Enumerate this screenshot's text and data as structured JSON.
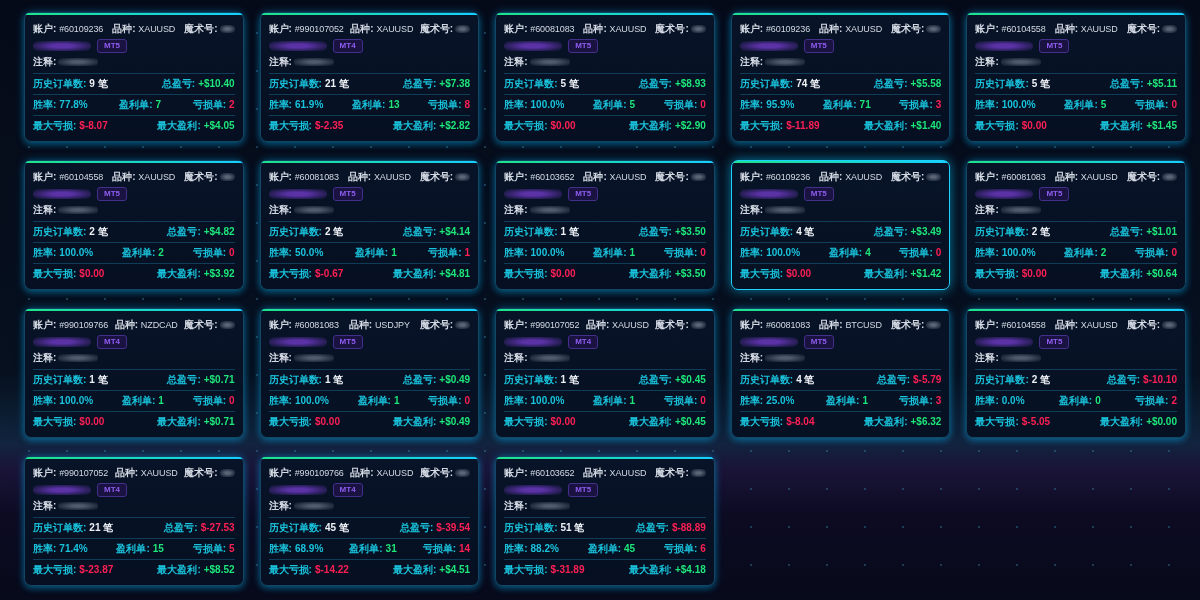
{
  "cards": [
    {
      "selected": false,
      "account": {
        "label": "账户:",
        "value": "#60109236"
      },
      "symbol": {
        "label": "品种:",
        "value": "XAUUSD"
      },
      "magic": {
        "label": "魔术号:"
      },
      "platform": "MT5",
      "note": {
        "label": "注释:"
      },
      "orders": {
        "label": "历史订单数:",
        "value": "9 笔"
      },
      "total_pnl": {
        "label": "总盈亏:",
        "value": "+$10.40",
        "color": "#1ee67a"
      },
      "win_rate": {
        "label": "胜率:",
        "value": "77.8%"
      },
      "wins": {
        "label": "盈利单:",
        "value": "7"
      },
      "losses": {
        "label": "亏损单:",
        "value": "2"
      },
      "max_loss": {
        "label": "最大亏损:",
        "value": "$-8.07"
      },
      "max_profit": {
        "label": "最大盈利:",
        "value": "+$4.05"
      }
    },
    {
      "selected": false,
      "account": {
        "label": "账户:",
        "value": "#990107052"
      },
      "symbol": {
        "label": "品种:",
        "value": "XAUUSD"
      },
      "magic": {
        "label": "魔术号:"
      },
      "platform": "MT4",
      "note": {
        "label": "注释:"
      },
      "orders": {
        "label": "历史订单数:",
        "value": "21 笔"
      },
      "total_pnl": {
        "label": "总盈亏:",
        "value": "+$7.38",
        "color": "#1ee67a"
      },
      "win_rate": {
        "label": "胜率:",
        "value": "61.9%"
      },
      "wins": {
        "label": "盈利单:",
        "value": "13"
      },
      "losses": {
        "label": "亏损单:",
        "value": "8"
      },
      "max_loss": {
        "label": "最大亏损:",
        "value": "$-2.35"
      },
      "max_profit": {
        "label": "最大盈利:",
        "value": "+$2.82"
      }
    },
    {
      "selected": false,
      "account": {
        "label": "账户:",
        "value": "#60081083"
      },
      "symbol": {
        "label": "品种:",
        "value": "XAUUSD"
      },
      "magic": {
        "label": "魔术号:"
      },
      "platform": "MT5",
      "note": {
        "label": "注释:"
      },
      "orders": {
        "label": "历史订单数:",
        "value": "5 笔"
      },
      "total_pnl": {
        "label": "总盈亏:",
        "value": "+$8.93",
        "color": "#1ee67a"
      },
      "win_rate": {
        "label": "胜率:",
        "value": "100.0%"
      },
      "wins": {
        "label": "盈利单:",
        "value": "5"
      },
      "losses": {
        "label": "亏损单:",
        "value": "0"
      },
      "max_loss": {
        "label": "最大亏损:",
        "value": "$0.00"
      },
      "max_profit": {
        "label": "最大盈利:",
        "value": "+$2.90"
      }
    },
    {
      "selected": false,
      "account": {
        "label": "账户:",
        "value": "#60109236"
      },
      "symbol": {
        "label": "品种:",
        "value": "XAUUSD"
      },
      "magic": {
        "label": "魔术号:"
      },
      "platform": "MT5",
      "note": {
        "label": "注释:"
      },
      "orders": {
        "label": "历史订单数:",
        "value": "74 笔"
      },
      "total_pnl": {
        "label": "总盈亏:",
        "value": "+$5.58",
        "color": "#1ee67a"
      },
      "win_rate": {
        "label": "胜率:",
        "value": "95.9%"
      },
      "wins": {
        "label": "盈利单:",
        "value": "71"
      },
      "losses": {
        "label": "亏损单:",
        "value": "3"
      },
      "max_loss": {
        "label": "最大亏损:",
        "value": "$-11.89"
      },
      "max_profit": {
        "label": "最大盈利:",
        "value": "+$1.40"
      }
    },
    {
      "selected": false,
      "account": {
        "label": "账户:",
        "value": "#60104558"
      },
      "symbol": {
        "label": "品种:",
        "value": "XAUUSD"
      },
      "magic": {
        "label": "魔术号:"
      },
      "platform": "MT5",
      "note": {
        "label": "注释:"
      },
      "orders": {
        "label": "历史订单数:",
        "value": "5 笔"
      },
      "total_pnl": {
        "label": "总盈亏:",
        "value": "+$5.11",
        "color": "#1ee67a"
      },
      "win_rate": {
        "label": "胜率:",
        "value": "100.0%"
      },
      "wins": {
        "label": "盈利单:",
        "value": "5"
      },
      "losses": {
        "label": "亏损单:",
        "value": "0"
      },
      "max_loss": {
        "label": "最大亏损:",
        "value": "$0.00"
      },
      "max_profit": {
        "label": "最大盈利:",
        "value": "+$1.45"
      }
    },
    {
      "selected": false,
      "account": {
        "label": "账户:",
        "value": "#60104558"
      },
      "symbol": {
        "label": "品种:",
        "value": "XAUUSD"
      },
      "magic": {
        "label": "魔术号:"
      },
      "platform": "MT5",
      "note": {
        "label": "注释:"
      },
      "orders": {
        "label": "历史订单数:",
        "value": "2 笔"
      },
      "total_pnl": {
        "label": "总盈亏:",
        "value": "+$4.82",
        "color": "#1ee67a"
      },
      "win_rate": {
        "label": "胜率:",
        "value": "100.0%"
      },
      "wins": {
        "label": "盈利单:",
        "value": "2"
      },
      "losses": {
        "label": "亏损单:",
        "value": "0"
      },
      "max_loss": {
        "label": "最大亏损:",
        "value": "$0.00"
      },
      "max_profit": {
        "label": "最大盈利:",
        "value": "+$3.92"
      }
    },
    {
      "selected": false,
      "account": {
        "label": "账户:",
        "value": "#60081083"
      },
      "symbol": {
        "label": "品种:",
        "value": "XAUUSD"
      },
      "magic": {
        "label": "魔术号:"
      },
      "platform": "MT5",
      "note": {
        "label": "注释:"
      },
      "orders": {
        "label": "历史订单数:",
        "value": "2 笔"
      },
      "total_pnl": {
        "label": "总盈亏:",
        "value": "+$4.14",
        "color": "#1ee67a"
      },
      "win_rate": {
        "label": "胜率:",
        "value": "50.0%"
      },
      "wins": {
        "label": "盈利单:",
        "value": "1"
      },
      "losses": {
        "label": "亏损单:",
        "value": "1"
      },
      "max_loss": {
        "label": "最大亏损:",
        "value": "$-0.67"
      },
      "max_profit": {
        "label": "最大盈利:",
        "value": "+$4.81"
      }
    },
    {
      "selected": false,
      "account": {
        "label": "账户:",
        "value": "#60103652"
      },
      "symbol": {
        "label": "品种:",
        "value": "XAUUSD"
      },
      "magic": {
        "label": "魔术号:"
      },
      "platform": "MT5",
      "note": {
        "label": "注释:"
      },
      "orders": {
        "label": "历史订单数:",
        "value": "1 笔"
      },
      "total_pnl": {
        "label": "总盈亏:",
        "value": "+$3.50",
        "color": "#1ee67a"
      },
      "win_rate": {
        "label": "胜率:",
        "value": "100.0%"
      },
      "wins": {
        "label": "盈利单:",
        "value": "1"
      },
      "losses": {
        "label": "亏损单:",
        "value": "0"
      },
      "max_loss": {
        "label": "最大亏损:",
        "value": "$0.00"
      },
      "max_profit": {
        "label": "最大盈利:",
        "value": "+$3.50"
      }
    },
    {
      "selected": true,
      "account": {
        "label": "账户:",
        "value": "#60109236"
      },
      "symbol": {
        "label": "品种:",
        "value": "XAUUSD"
      },
      "magic": {
        "label": "魔术号:"
      },
      "platform": "MT5",
      "note": {
        "label": "注释:"
      },
      "orders": {
        "label": "历史订单数:",
        "value": "4 笔"
      },
      "total_pnl": {
        "label": "总盈亏:",
        "value": "+$3.49",
        "color": "#1ee67a"
      },
      "win_rate": {
        "label": "胜率:",
        "value": "100.0%"
      },
      "wins": {
        "label": "盈利单:",
        "value": "4"
      },
      "losses": {
        "label": "亏损单:",
        "value": "0"
      },
      "max_loss": {
        "label": "最大亏损:",
        "value": "$0.00"
      },
      "max_profit": {
        "label": "最大盈利:",
        "value": "+$1.42"
      }
    },
    {
      "selected": false,
      "account": {
        "label": "账户:",
        "value": "#60081083"
      },
      "symbol": {
        "label": "品种:",
        "value": "XAUUSD"
      },
      "magic": {
        "label": "魔术号:"
      },
      "platform": "MT5",
      "note": {
        "label": "注释:"
      },
      "orders": {
        "label": "历史订单数:",
        "value": "2 笔"
      },
      "total_pnl": {
        "label": "总盈亏:",
        "value": "+$1.01",
        "color": "#1ee67a"
      },
      "win_rate": {
        "label": "胜率:",
        "value": "100.0%"
      },
      "wins": {
        "label": "盈利单:",
        "value": "2"
      },
      "losses": {
        "label": "亏损单:",
        "value": "0"
      },
      "max_loss": {
        "label": "最大亏损:",
        "value": "$0.00"
      },
      "max_profit": {
        "label": "最大盈利:",
        "value": "+$0.64"
      }
    },
    {
      "selected": false,
      "account": {
        "label": "账户:",
        "value": "#990109766"
      },
      "symbol": {
        "label": "品种:",
        "value": "NZDCAD"
      },
      "magic": {
        "label": "魔术号:"
      },
      "platform": "MT4",
      "note": {
        "label": "注释:"
      },
      "orders": {
        "label": "历史订单数:",
        "value": "1 笔"
      },
      "total_pnl": {
        "label": "总盈亏:",
        "value": "+$0.71",
        "color": "#1ee67a"
      },
      "win_rate": {
        "label": "胜率:",
        "value": "100.0%"
      },
      "wins": {
        "label": "盈利单:",
        "value": "1"
      },
      "losses": {
        "label": "亏损单:",
        "value": "0"
      },
      "max_loss": {
        "label": "最大亏损:",
        "value": "$0.00"
      },
      "max_profit": {
        "label": "最大盈利:",
        "value": "+$0.71"
      }
    },
    {
      "selected": false,
      "account": {
        "label": "账户:",
        "value": "#60081083"
      },
      "symbol": {
        "label": "品种:",
        "value": "USDJPY"
      },
      "magic": {
        "label": "魔术号:"
      },
      "platform": "MT5",
      "note": {
        "label": "注释:"
      },
      "orders": {
        "label": "历史订单数:",
        "value": "1 笔"
      },
      "total_pnl": {
        "label": "总盈亏:",
        "value": "+$0.49",
        "color": "#1ee67a"
      },
      "win_rate": {
        "label": "胜率:",
        "value": "100.0%"
      },
      "wins": {
        "label": "盈利单:",
        "value": "1"
      },
      "losses": {
        "label": "亏损单:",
        "value": "0"
      },
      "max_loss": {
        "label": "最大亏损:",
        "value": "$0.00"
      },
      "max_profit": {
        "label": "最大盈利:",
        "value": "+$0.49"
      }
    },
    {
      "selected": false,
      "account": {
        "label": "账户:",
        "value": "#990107052"
      },
      "symbol": {
        "label": "品种:",
        "value": "XAUUSD"
      },
      "magic": {
        "label": "魔术号:"
      },
      "platform": "MT4",
      "note": {
        "label": "注释:"
      },
      "orders": {
        "label": "历史订单数:",
        "value": "1 笔"
      },
      "total_pnl": {
        "label": "总盈亏:",
        "value": "+$0.45",
        "color": "#1ee67a"
      },
      "win_rate": {
        "label": "胜率:",
        "value": "100.0%"
      },
      "wins": {
        "label": "盈利单:",
        "value": "1"
      },
      "losses": {
        "label": "亏损单:",
        "value": "0"
      },
      "max_loss": {
        "label": "最大亏损:",
        "value": "$0.00"
      },
      "max_profit": {
        "label": "最大盈利:",
        "value": "+$0.45"
      }
    },
    {
      "selected": false,
      "account": {
        "label": "账户:",
        "value": "#60081083"
      },
      "symbol": {
        "label": "品种:",
        "value": "BTCUSD"
      },
      "magic": {
        "label": "魔术号:"
      },
      "platform": "MT5",
      "note": {
        "label": "注释:"
      },
      "orders": {
        "label": "历史订单数:",
        "value": "4 笔"
      },
      "total_pnl": {
        "label": "总盈亏:",
        "value": "$-5.79",
        "color": "#ff1f55"
      },
      "win_rate": {
        "label": "胜率:",
        "value": "25.0%"
      },
      "wins": {
        "label": "盈利单:",
        "value": "1"
      },
      "losses": {
        "label": "亏损单:",
        "value": "3"
      },
      "max_loss": {
        "label": "最大亏损:",
        "value": "$-8.04"
      },
      "max_profit": {
        "label": "最大盈利:",
        "value": "+$6.32"
      }
    },
    {
      "selected": false,
      "account": {
        "label": "账户:",
        "value": "#60104558"
      },
      "symbol": {
        "label": "品种:",
        "value": "XAUUSD"
      },
      "magic": {
        "label": "魔术号:"
      },
      "platform": "MT5",
      "note": {
        "label": "注释:"
      },
      "orders": {
        "label": "历史订单数:",
        "value": "2 笔"
      },
      "total_pnl": {
        "label": "总盈亏:",
        "value": "$-10.10",
        "color": "#ff1f55"
      },
      "win_rate": {
        "label": "胜率:",
        "value": "0.0%"
      },
      "wins": {
        "label": "盈利单:",
        "value": "0"
      },
      "losses": {
        "label": "亏损单:",
        "value": "2"
      },
      "max_loss": {
        "label": "最大亏损:",
        "value": "$-5.05"
      },
      "max_profit": {
        "label": "最大盈利:",
        "value": "+$0.00"
      }
    },
    {
      "selected": false,
      "account": {
        "label": "账户:",
        "value": "#990107052"
      },
      "symbol": {
        "label": "品种:",
        "value": "XAUUSD"
      },
      "magic": {
        "label": "魔术号:"
      },
      "platform": "MT4",
      "note": {
        "label": "注释:"
      },
      "orders": {
        "label": "历史订单数:",
        "value": "21 笔"
      },
      "total_pnl": {
        "label": "总盈亏:",
        "value": "$-27.53",
        "color": "#ff1f55"
      },
      "win_rate": {
        "label": "胜率:",
        "value": "71.4%"
      },
      "wins": {
        "label": "盈利单:",
        "value": "15"
      },
      "losses": {
        "label": "亏损单:",
        "value": "5"
      },
      "max_loss": {
        "label": "最大亏损:",
        "value": "$-23.87"
      },
      "max_profit": {
        "label": "最大盈利:",
        "value": "+$8.52"
      }
    },
    {
      "selected": false,
      "account": {
        "label": "账户:",
        "value": "#990109766"
      },
      "symbol": {
        "label": "品种:",
        "value": "XAUUSD"
      },
      "magic": {
        "label": "魔术号:"
      },
      "platform": "MT4",
      "note": {
        "label": "注释:"
      },
      "orders": {
        "label": "历史订单数:",
        "value": "45 笔"
      },
      "total_pnl": {
        "label": "总盈亏:",
        "value": "$-39.54",
        "color": "#ff1f55"
      },
      "win_rate": {
        "label": "胜率:",
        "value": "68.9%"
      },
      "wins": {
        "label": "盈利单:",
        "value": "31"
      },
      "losses": {
        "label": "亏损单:",
        "value": "14"
      },
      "max_loss": {
        "label": "最大亏损:",
        "value": "$-14.22"
      },
      "max_profit": {
        "label": "最大盈利:",
        "value": "+$4.51"
      }
    },
    {
      "selected": false,
      "account": {
        "label": "账户:",
        "value": "#60103652"
      },
      "symbol": {
        "label": "品种:",
        "value": "XAUUSD"
      },
      "magic": {
        "label": "魔术号:"
      },
      "platform": "MT5",
      "note": {
        "label": "注释:"
      },
      "orders": {
        "label": "历史订单数:",
        "value": "51 笔"
      },
      "total_pnl": {
        "label": "总盈亏:",
        "value": "$-88.89",
        "color": "#ff1f55"
      },
      "win_rate": {
        "label": "胜率:",
        "value": "88.2%"
      },
      "wins": {
        "label": "盈利单:",
        "value": "45"
      },
      "losses": {
        "label": "亏损单:",
        "value": "6"
      },
      "max_loss": {
        "label": "最大亏损:",
        "value": "$-31.89"
      },
      "max_profit": {
        "label": "最大盈利:",
        "value": "+$4.18"
      }
    }
  ]
}
